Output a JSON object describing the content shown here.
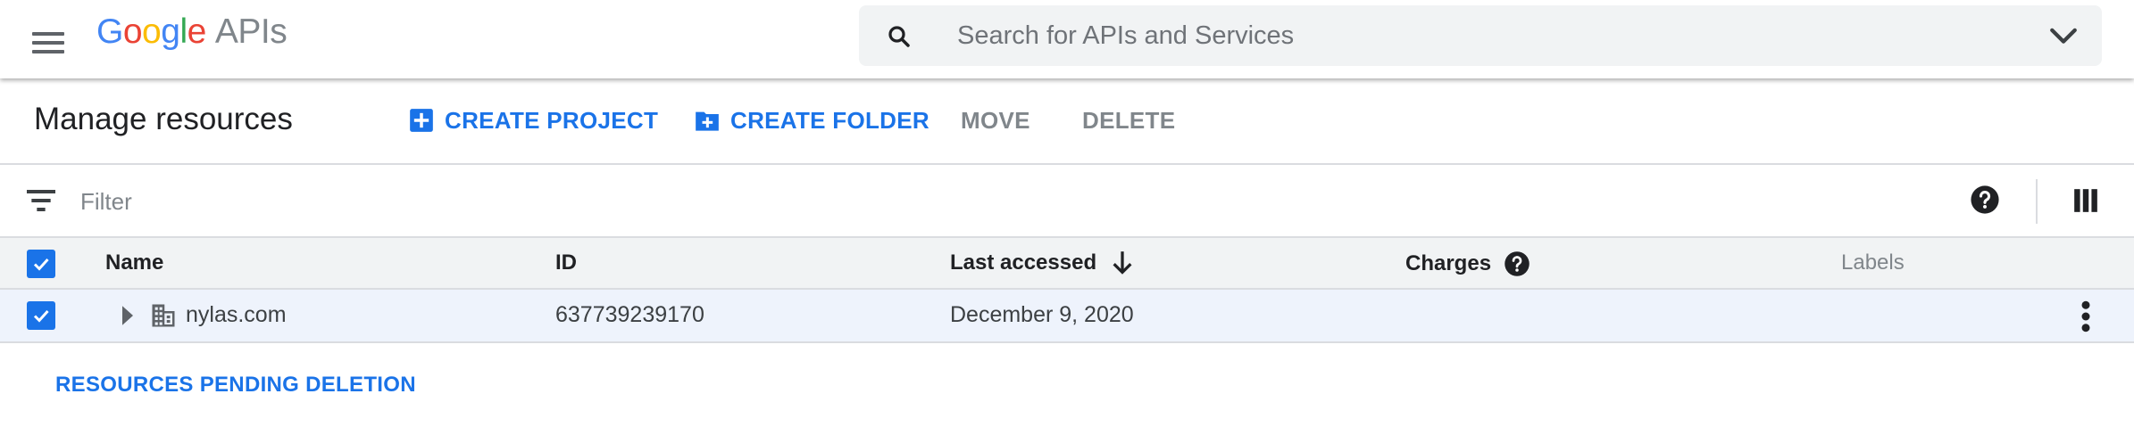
{
  "header": {
    "logo": {
      "letters": [
        "G",
        "o",
        "o",
        "g",
        "l",
        "e"
      ],
      "product": "APIs"
    },
    "search": {
      "placeholder": "Search for APIs and Services",
      "value": ""
    }
  },
  "toolbar": {
    "title": "Manage resources",
    "create_project": "CREATE PROJECT",
    "create_folder": "CREATE FOLDER",
    "move": "MOVE",
    "delete": "DELETE"
  },
  "filter": {
    "placeholder": "Filter",
    "value": ""
  },
  "table": {
    "columns": {
      "name": "Name",
      "id": "ID",
      "last_accessed": "Last accessed",
      "charges": "Charges",
      "labels": "Labels"
    },
    "sort": {
      "column": "last_accessed",
      "direction": "descending"
    },
    "select_all_checked": true,
    "rows": [
      {
        "checked": true,
        "name": "nylas.com",
        "id": "637739239170",
        "last_accessed": "December 9, 2020",
        "charges": "",
        "labels": ""
      }
    ]
  },
  "footer": {
    "pending_deletion": "RESOURCES PENDING DELETION"
  },
  "icons": {
    "menu": "menu-icon",
    "search": "search-icon",
    "dropdown": "chevron-down-icon",
    "create_project": "add-box-icon",
    "create_folder": "create-folder-icon",
    "filter": "filter-list-icon",
    "help": "help-icon",
    "columns": "column-display-icon",
    "sort": "arrow-down-icon",
    "expand": "expand-arrow-icon",
    "organization": "organization-icon",
    "more": "more-vert-icon"
  },
  "colors": {
    "accent": "#1a73e8",
    "row_selected_bg": "#eef3fc",
    "header_bg": "#f1f3f4",
    "disabled_text": "#80868b"
  }
}
